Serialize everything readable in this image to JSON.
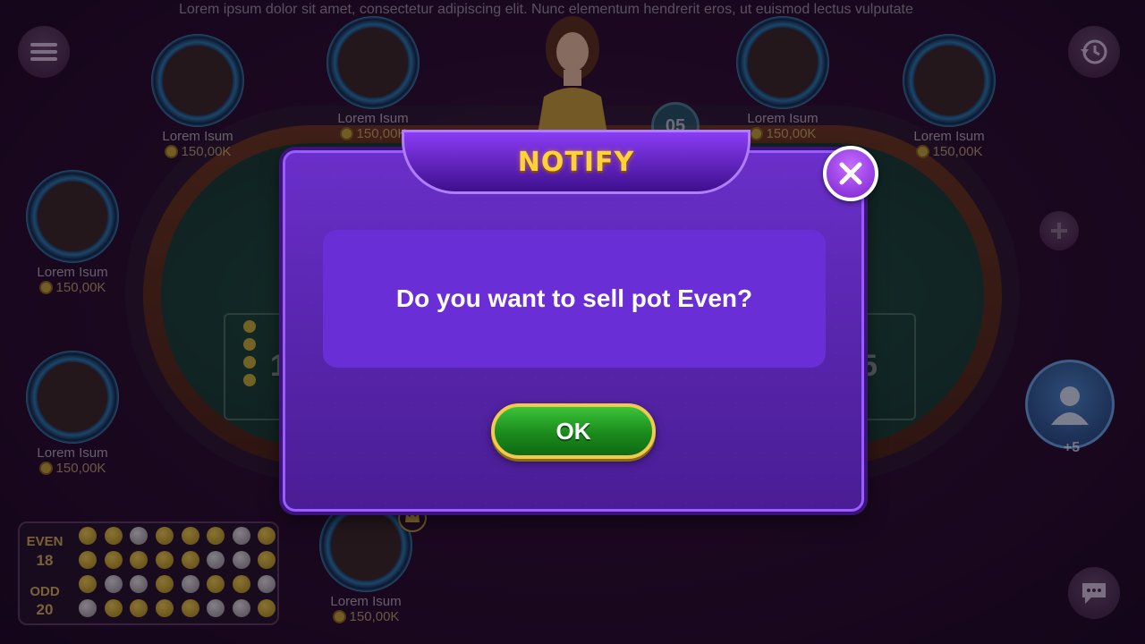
{
  "ticker": {
    "text": "Lorem ipsum dolor sit amet, consectetur adipiscing elit. Nunc elementum hendrerit eros, ut euismod lectus vulputate"
  },
  "table": {
    "timer": "05",
    "pot_left": "1",
    "pot_right": "5"
  },
  "players": [
    {
      "name": "Lorem Isum",
      "coins": "150,00K"
    },
    {
      "name": "Lorem Isum",
      "coins": "150,00K"
    },
    {
      "name": "Lorem Isum",
      "coins": "150,00K"
    },
    {
      "name": "Lorem Isum",
      "coins": "150,00K"
    },
    {
      "name": "Lorem Isum",
      "coins": "150,00K"
    },
    {
      "name": "Lorem Isum",
      "coins": "150,00K"
    },
    {
      "name": "Lorem Isum",
      "coins": "150,00K"
    }
  ],
  "side": {
    "extra_players": "+5"
  },
  "board": {
    "even_label": "EVEN",
    "even_count": "18",
    "odd_label": "ODD",
    "odd_count": "20",
    "rows": [
      [
        "y",
        "y",
        "w",
        "y",
        "y",
        "y",
        "w",
        "y"
      ],
      [
        "y",
        "y",
        "y",
        "y",
        "y",
        "w",
        "w",
        "y"
      ],
      [
        "y",
        "w",
        "w",
        "y",
        "w",
        "y",
        "y",
        "w"
      ],
      [
        "w",
        "y",
        "y",
        "y",
        "y",
        "w",
        "w",
        "y"
      ]
    ]
  },
  "dialog": {
    "title": "NOTIFY",
    "message": "Do you want to sell pot Even?",
    "ok_label": "OK"
  },
  "colors": {
    "modal_purple": "#5524a8",
    "title_gold": "#ffd23a",
    "ok_green": "#1b8a1d",
    "ok_border": "#f2c94c"
  },
  "icons": [
    "menu-icon",
    "history-icon",
    "close-icon",
    "add-icon",
    "user-icon",
    "chat-icon",
    "crown-icon",
    "coin-icon"
  ]
}
